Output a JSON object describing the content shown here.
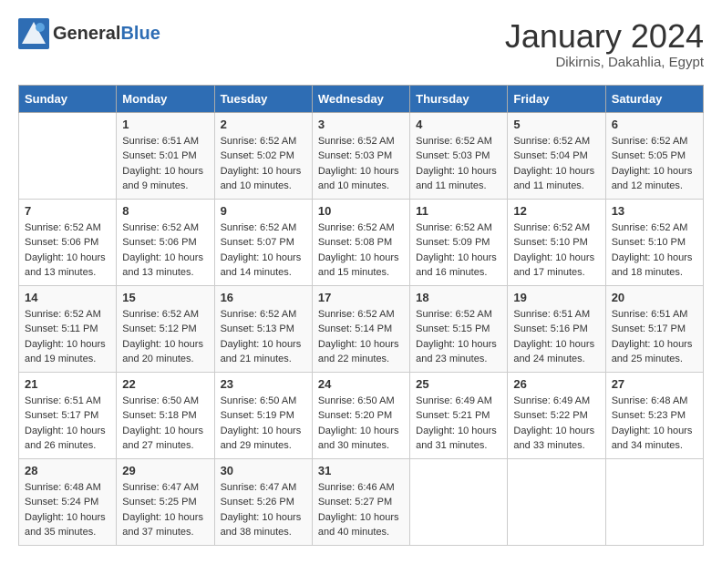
{
  "header": {
    "logo_general": "General",
    "logo_blue": "Blue",
    "title": "January 2024",
    "location": "Dikirnis, Dakahlia, Egypt"
  },
  "calendar": {
    "days_of_week": [
      "Sunday",
      "Monday",
      "Tuesday",
      "Wednesday",
      "Thursday",
      "Friday",
      "Saturday"
    ],
    "weeks": [
      [
        {
          "day": "",
          "info": ""
        },
        {
          "day": "1",
          "info": "Sunrise: 6:51 AM\nSunset: 5:01 PM\nDaylight: 10 hours\nand 9 minutes."
        },
        {
          "day": "2",
          "info": "Sunrise: 6:52 AM\nSunset: 5:02 PM\nDaylight: 10 hours\nand 10 minutes."
        },
        {
          "day": "3",
          "info": "Sunrise: 6:52 AM\nSunset: 5:03 PM\nDaylight: 10 hours\nand 10 minutes."
        },
        {
          "day": "4",
          "info": "Sunrise: 6:52 AM\nSunset: 5:03 PM\nDaylight: 10 hours\nand 11 minutes."
        },
        {
          "day": "5",
          "info": "Sunrise: 6:52 AM\nSunset: 5:04 PM\nDaylight: 10 hours\nand 11 minutes."
        },
        {
          "day": "6",
          "info": "Sunrise: 6:52 AM\nSunset: 5:05 PM\nDaylight: 10 hours\nand 12 minutes."
        }
      ],
      [
        {
          "day": "7",
          "info": "Sunrise: 6:52 AM\nSunset: 5:06 PM\nDaylight: 10 hours\nand 13 minutes."
        },
        {
          "day": "8",
          "info": "Sunrise: 6:52 AM\nSunset: 5:06 PM\nDaylight: 10 hours\nand 13 minutes."
        },
        {
          "day": "9",
          "info": "Sunrise: 6:52 AM\nSunset: 5:07 PM\nDaylight: 10 hours\nand 14 minutes."
        },
        {
          "day": "10",
          "info": "Sunrise: 6:52 AM\nSunset: 5:08 PM\nDaylight: 10 hours\nand 15 minutes."
        },
        {
          "day": "11",
          "info": "Sunrise: 6:52 AM\nSunset: 5:09 PM\nDaylight: 10 hours\nand 16 minutes."
        },
        {
          "day": "12",
          "info": "Sunrise: 6:52 AM\nSunset: 5:10 PM\nDaylight: 10 hours\nand 17 minutes."
        },
        {
          "day": "13",
          "info": "Sunrise: 6:52 AM\nSunset: 5:10 PM\nDaylight: 10 hours\nand 18 minutes."
        }
      ],
      [
        {
          "day": "14",
          "info": "Sunrise: 6:52 AM\nSunset: 5:11 PM\nDaylight: 10 hours\nand 19 minutes."
        },
        {
          "day": "15",
          "info": "Sunrise: 6:52 AM\nSunset: 5:12 PM\nDaylight: 10 hours\nand 20 minutes."
        },
        {
          "day": "16",
          "info": "Sunrise: 6:52 AM\nSunset: 5:13 PM\nDaylight: 10 hours\nand 21 minutes."
        },
        {
          "day": "17",
          "info": "Sunrise: 6:52 AM\nSunset: 5:14 PM\nDaylight: 10 hours\nand 22 minutes."
        },
        {
          "day": "18",
          "info": "Sunrise: 6:52 AM\nSunset: 5:15 PM\nDaylight: 10 hours\nand 23 minutes."
        },
        {
          "day": "19",
          "info": "Sunrise: 6:51 AM\nSunset: 5:16 PM\nDaylight: 10 hours\nand 24 minutes."
        },
        {
          "day": "20",
          "info": "Sunrise: 6:51 AM\nSunset: 5:17 PM\nDaylight: 10 hours\nand 25 minutes."
        }
      ],
      [
        {
          "day": "21",
          "info": "Sunrise: 6:51 AM\nSunset: 5:17 PM\nDaylight: 10 hours\nand 26 minutes."
        },
        {
          "day": "22",
          "info": "Sunrise: 6:50 AM\nSunset: 5:18 PM\nDaylight: 10 hours\nand 27 minutes."
        },
        {
          "day": "23",
          "info": "Sunrise: 6:50 AM\nSunset: 5:19 PM\nDaylight: 10 hours\nand 29 minutes."
        },
        {
          "day": "24",
          "info": "Sunrise: 6:50 AM\nSunset: 5:20 PM\nDaylight: 10 hours\nand 30 minutes."
        },
        {
          "day": "25",
          "info": "Sunrise: 6:49 AM\nSunset: 5:21 PM\nDaylight: 10 hours\nand 31 minutes."
        },
        {
          "day": "26",
          "info": "Sunrise: 6:49 AM\nSunset: 5:22 PM\nDaylight: 10 hours\nand 33 minutes."
        },
        {
          "day": "27",
          "info": "Sunrise: 6:48 AM\nSunset: 5:23 PM\nDaylight: 10 hours\nand 34 minutes."
        }
      ],
      [
        {
          "day": "28",
          "info": "Sunrise: 6:48 AM\nSunset: 5:24 PM\nDaylight: 10 hours\nand 35 minutes."
        },
        {
          "day": "29",
          "info": "Sunrise: 6:47 AM\nSunset: 5:25 PM\nDaylight: 10 hours\nand 37 minutes."
        },
        {
          "day": "30",
          "info": "Sunrise: 6:47 AM\nSunset: 5:26 PM\nDaylight: 10 hours\nand 38 minutes."
        },
        {
          "day": "31",
          "info": "Sunrise: 6:46 AM\nSunset: 5:27 PM\nDaylight: 10 hours\nand 40 minutes."
        },
        {
          "day": "",
          "info": ""
        },
        {
          "day": "",
          "info": ""
        },
        {
          "day": "",
          "info": ""
        }
      ]
    ]
  }
}
